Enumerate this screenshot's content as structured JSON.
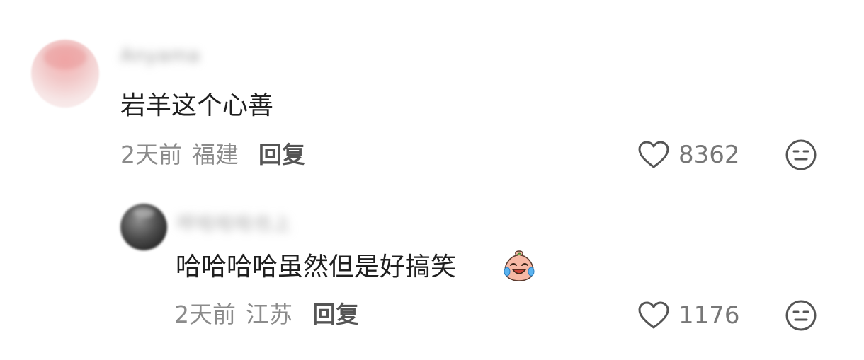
{
  "comments": [
    {
      "username": "Anyama",
      "text": "岩羊这个心善",
      "time": "2天前",
      "location": "福建",
      "reply_label": "回复",
      "likes": "8362"
    },
    {
      "username": "呼哈哈哈也上",
      "text": "哈哈哈哈虽然但是好搞笑",
      "time": "2天前",
      "location": "江苏",
      "reply_label": "回复",
      "likes": "1176",
      "emoji": "laughing-tears-emoji"
    }
  ],
  "icons": {
    "like": "heart-outline-icon",
    "dislike": "neutral-face-icon"
  },
  "colors": {
    "text": "#1f1f1f",
    "meta": "#8b8b8b",
    "reply": "#555555",
    "count": "#777777"
  }
}
